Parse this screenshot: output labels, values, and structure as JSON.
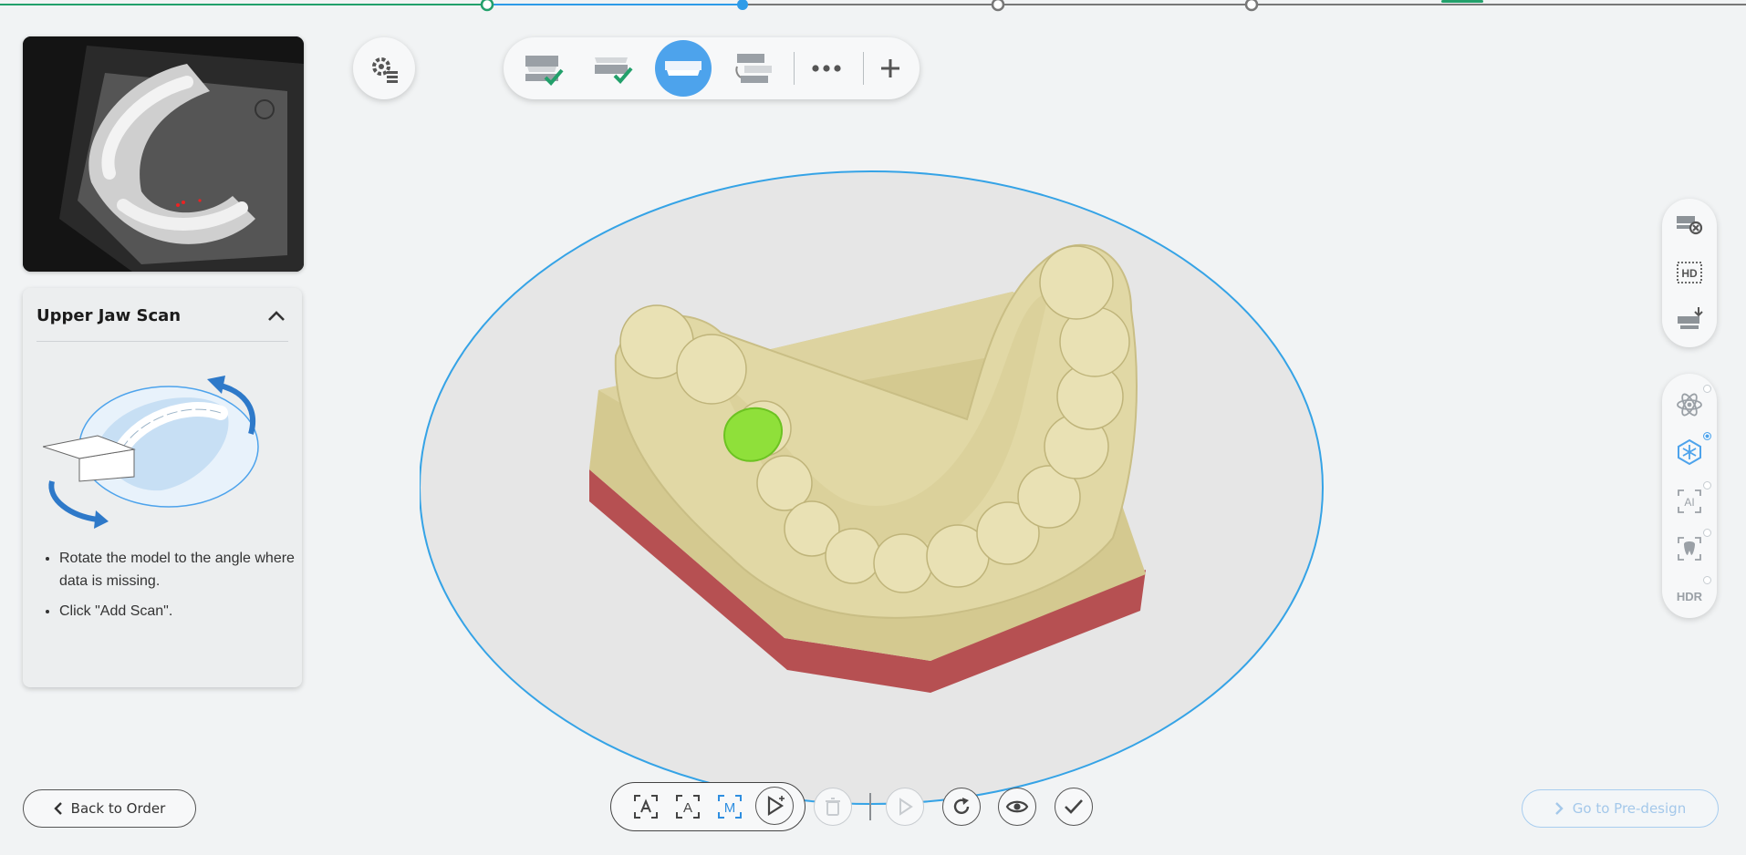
{
  "progress": {
    "accent": "#2e9be8",
    "done_color": "#22a06b"
  },
  "guide": {
    "title": "Upper Jaw Scan",
    "steps": [
      "Rotate the model to the angle where data is missing.",
      "Click \"Add Scan\"."
    ]
  },
  "toolbar": {
    "settings_icon": "gear-list-icon",
    "steps": [
      {
        "icon": "upper-jaw-done-icon",
        "status": "done"
      },
      {
        "icon": "lower-jaw-done-icon",
        "status": "done"
      },
      {
        "icon": "jaw-scan-icon",
        "status": "active"
      },
      {
        "icon": "bite-align-icon",
        "status": "pending"
      }
    ],
    "more_icon": "more-icon",
    "add_icon": "plus-icon"
  },
  "side_tools": {
    "top": [
      "scan-cleanup-icon",
      "hd-icon",
      "texture-download-icon"
    ],
    "bottom": [
      {
        "icon": "atom-icon",
        "on": false
      },
      {
        "icon": "snowflake-icon",
        "on": true
      },
      {
        "label": "AI",
        "icon": "ai-scan-icon",
        "on": false
      },
      {
        "icon": "tooth-scan-icon",
        "on": false
      },
      {
        "label": "HDR",
        "icon": "hdr-icon",
        "on": false
      }
    ]
  },
  "bottom": {
    "back_label": "Back to Order",
    "next_label": "Go to Pre-design",
    "scan_modes": [
      "A",
      "M"
    ],
    "actions": [
      "play-icon",
      "delete-icon",
      "resume-icon",
      "refresh-icon",
      "eye-icon",
      "check-icon"
    ]
  },
  "colors": {
    "accent": "#4da3ec",
    "model": "#d9cf9b",
    "base": "#b65052",
    "highlight": "#8fe03a"
  }
}
